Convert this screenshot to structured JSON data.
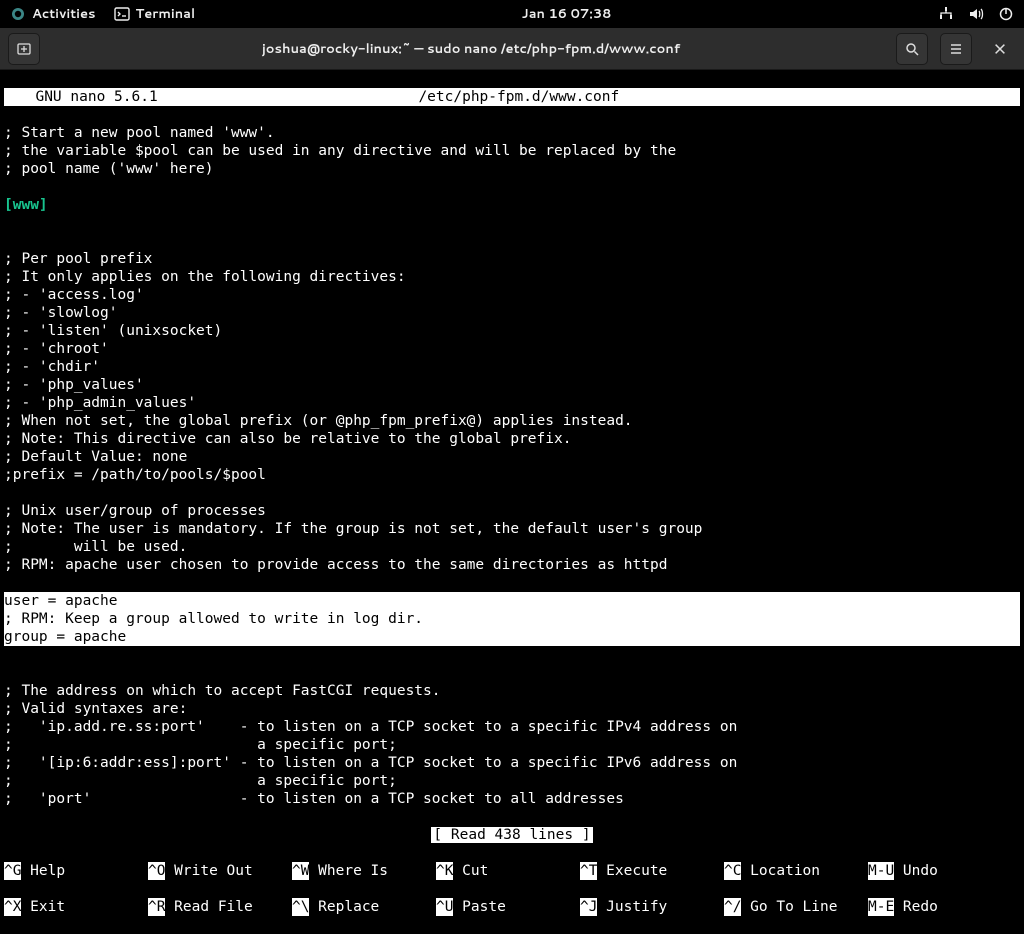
{
  "gnome": {
    "activities": "Activities",
    "app": "Terminal",
    "clock": "Jan 16  07:38"
  },
  "window": {
    "title": "joshua@rocky-linux:~ — sudo nano /etc/php-fpm.d/www.conf"
  },
  "nano": {
    "header_left": "  GNU nano 5.6.1",
    "header_file": "/etc/php-fpm.d/www.conf",
    "status": "[ Read 438 lines ]",
    "section_header": "[www]"
  },
  "content_top": [
    "; Start a new pool named 'www'.",
    "; the variable $pool can be used in any directive and will be replaced by the",
    "; pool name ('www' here)"
  ],
  "content_mid": [
    "",
    "; Per pool prefix",
    "; It only applies on the following directives:",
    "; - 'access.log'",
    "; - 'slowlog'",
    "; - 'listen' (unixsocket)",
    "; - 'chroot'",
    "; - 'chdir'",
    "; - 'php_values'",
    "; - 'php_admin_values'",
    "; When not set, the global prefix (or @php_fpm_prefix@) applies instead.",
    "; Note: This directive can also be relative to the global prefix.",
    "; Default Value: none",
    ";prefix = /path/to/pools/$pool",
    "",
    "; Unix user/group of processes",
    "; Note: The user is mandatory. If the group is not set, the default user's group",
    ";       will be used.",
    "; RPM: apache user chosen to provide access to the same directories as httpd"
  ],
  "content_selected": [
    "user = apache",
    "; RPM: Keep a group allowed to write in log dir.",
    "group = apache"
  ],
  "content_bottom": [
    "",
    "; The address on which to accept FastCGI requests.",
    "; Valid syntaxes are:",
    ";   'ip.add.re.ss:port'    - to listen on a TCP socket to a specific IPv4 address on",
    ";                            a specific port;",
    ";   '[ip:6:addr:ess]:port' - to listen on a TCP socket to a specific IPv6 address on",
    ";                            a specific port;",
    ";   'port'                 - to listen on a TCP socket to all addresses"
  ],
  "shortcuts_row1": [
    {
      "key": "^G",
      "label": "Help"
    },
    {
      "key": "^O",
      "label": "Write Out"
    },
    {
      "key": "^W",
      "label": "Where Is"
    },
    {
      "key": "^K",
      "label": "Cut"
    },
    {
      "key": "^T",
      "label": "Execute"
    },
    {
      "key": "^C",
      "label": "Location"
    },
    {
      "key": "M-U",
      "label": "Undo"
    }
  ],
  "shortcuts_row2": [
    {
      "key": "^X",
      "label": "Exit"
    },
    {
      "key": "^R",
      "label": "Read File"
    },
    {
      "key": "^\\",
      "label": "Replace"
    },
    {
      "key": "^U",
      "label": "Paste"
    },
    {
      "key": "^J",
      "label": "Justify"
    },
    {
      "key": "^/",
      "label": "Go To Line"
    },
    {
      "key": "M-E",
      "label": "Redo"
    }
  ]
}
